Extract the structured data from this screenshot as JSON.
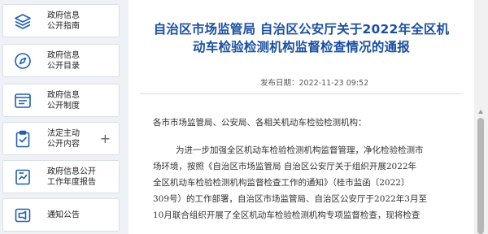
{
  "sidebar": {
    "items": [
      {
        "line1": "政府信息",
        "line2": "公开指南",
        "icon": "layers-icon"
      },
      {
        "line1": "政府信息",
        "line2": "公开目录",
        "icon": "compass-icon"
      },
      {
        "line1": "政府信息",
        "line2": "公开制度",
        "icon": "document-list-icon"
      },
      {
        "line1": "法定主动",
        "line2": "公开内容",
        "icon": "clipboard-check-icon",
        "expand": "+"
      },
      {
        "line1": "政府信息公开",
        "line2": "工作年度报告",
        "icon": "report-chart-icon"
      },
      {
        "line1": "通知公告",
        "line2": "",
        "icon": "announcement-icon"
      }
    ]
  },
  "article": {
    "title_line1": "自治区市场监管局 自治区公安厅关于2022年全区机",
    "title_line2": "动车检验检测机构监督检查情况的通报",
    "date_label": "发布日期：",
    "date_value": "2022-11-23 09:52",
    "salutation": "各市市场监管局、公安局、各相关机动车检验检测机构：",
    "para_lines": [
      "为进一步加强全区机动车检验检测机构监督管理，净化检验检测市",
      "场环境，按照《自治区市场监管局 自治区公安厅关于组织开展2022年",
      "全区机动车检验检测机构监督检查工作的通知》（桂市监函〔2022〕",
      "309号）的工作部署，自治区市场监管局、自治区公安厅于2022年3月至",
      "10月联合组织开展了全区机动车检验检测机构专项监督检查，现将检查"
    ]
  },
  "colors": {
    "title": "#1a4fa2",
    "icon": "#1f5fae",
    "background": "#eef1f6"
  }
}
